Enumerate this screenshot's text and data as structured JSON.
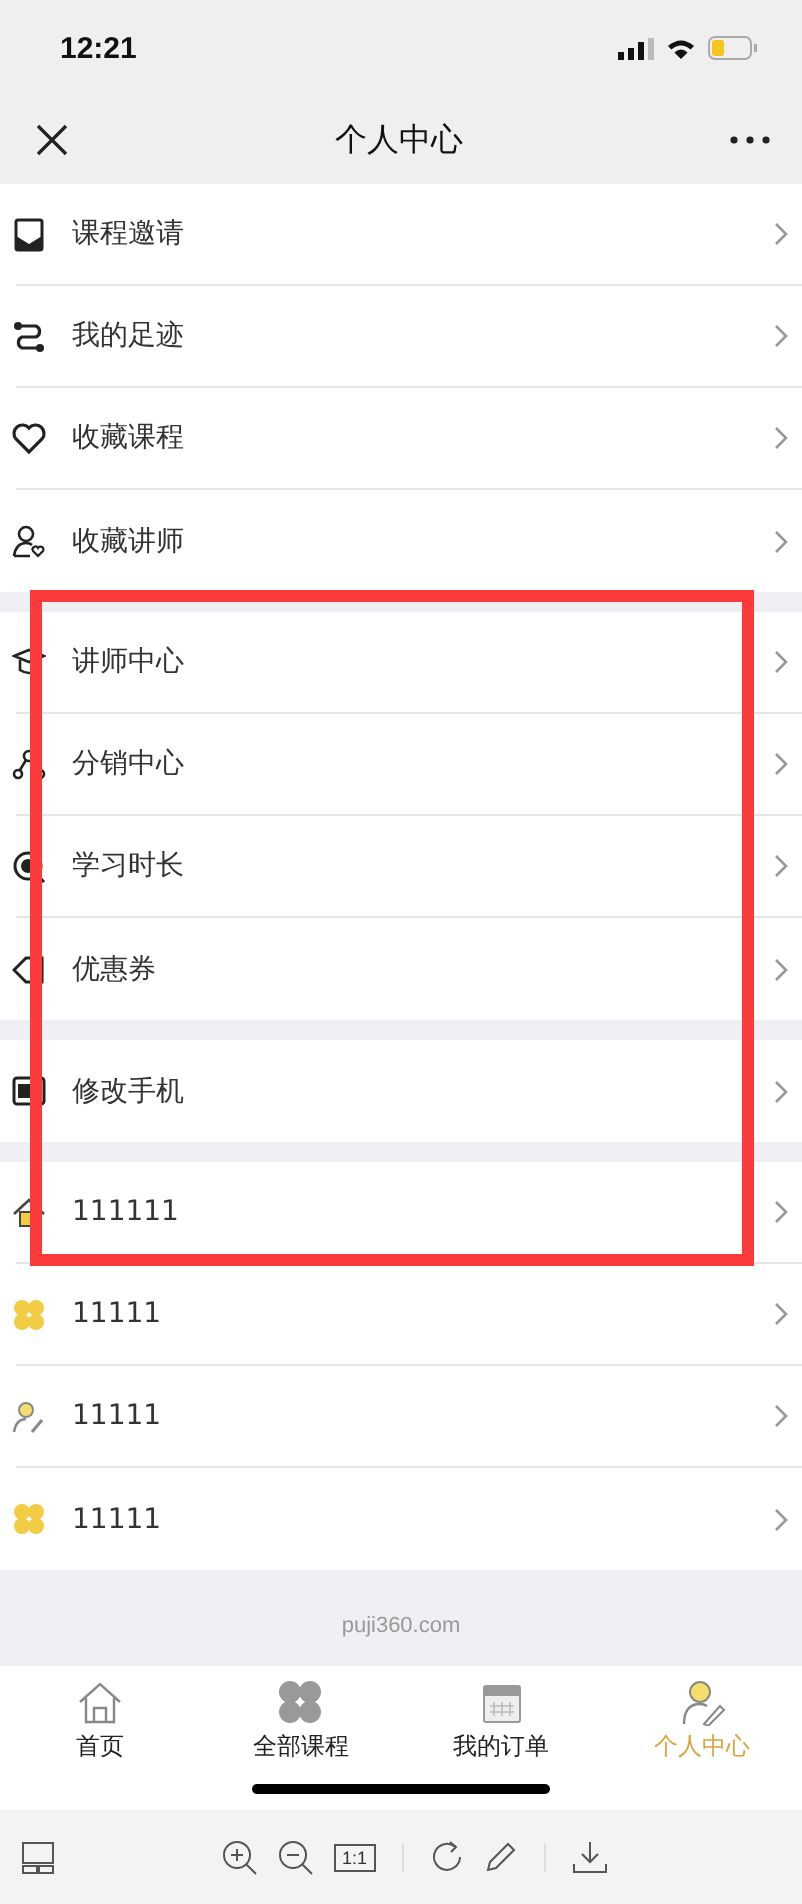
{
  "status_bar": {
    "time": "12:21"
  },
  "nav_bar": {
    "title": "个人中心"
  },
  "menu_groups": [
    [
      {
        "label": "课程邀请"
      },
      {
        "label": "我的足迹"
      },
      {
        "label": "收藏课程"
      },
      {
        "label": "收藏讲师"
      }
    ],
    [
      {
        "label": "讲师中心"
      },
      {
        "label": "分销中心"
      },
      {
        "label": "学习时长"
      },
      {
        "label": "优惠券"
      }
    ],
    [
      {
        "label": "修改手机"
      }
    ],
    [
      {
        "label": "111111"
      },
      {
        "label": "11111"
      },
      {
        "label": "11111"
      },
      {
        "label": "11111"
      }
    ]
  ],
  "footer": {
    "domain": "puji360.com"
  },
  "tab_bar": [
    {
      "label": "首页",
      "selected": false
    },
    {
      "label": "全部课程",
      "selected": false
    },
    {
      "label": "我的订单",
      "selected": false
    },
    {
      "label": "个人中心",
      "selected": true
    }
  ],
  "viewer_toolbar": {
    "actual_size": "1:1"
  }
}
